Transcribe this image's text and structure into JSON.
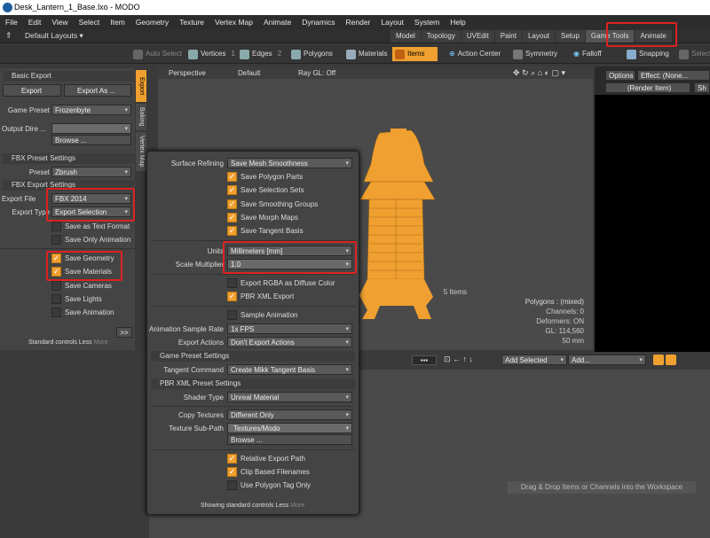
{
  "window_title": "Desk_Lantern_1_Base.lxo - MODO",
  "menu": [
    "File",
    "Edit",
    "View",
    "Select",
    "Item",
    "Geometry",
    "Texture",
    "Vertex Map",
    "Animate",
    "Dynamics",
    "Render",
    "Layout",
    "System",
    "Help"
  ],
  "layout_selector": "Default Layouts",
  "layout_tabs": [
    "Model",
    "Topology",
    "UVEdit",
    "Paint",
    "Layout",
    "Setup",
    "Game Tools",
    "Animate"
  ],
  "toolbar": {
    "auto_select": "Auto Select",
    "vertices": "Vertices",
    "vertices_count": "1",
    "edges": "Edges",
    "edges_count": "2",
    "polygons": "Polygons",
    "materials": "Materials",
    "items": "Items",
    "action_center": "Action Center",
    "symmetry": "Symmetry",
    "falloff": "Falloff",
    "snapping": "Snapping",
    "select": "Select"
  },
  "left_panel": {
    "basic_export_header": "Basic Export",
    "export_button": "Export",
    "export_as_button": "Export As ...",
    "game_preset_label": "Game Preset",
    "game_preset_value": "Frozenbyte",
    "output_dir_label": "Output Dire ...",
    "browse_button": "Browse ...",
    "fbx_preset_header": "FBX Preset Settings",
    "preset_label": "Preset",
    "preset_value": "Zbrush",
    "fbx_export_header": "FBX Export Settings",
    "export_file_label": "Export File",
    "export_file_value": "FBX 2014",
    "export_type_label": "Export Type",
    "export_type_value": "Export Selection",
    "save_text": "Save as Text Format",
    "save_anim_only": "Save Only Animation",
    "save_geometry": "Save Geometry",
    "save_materials": "Save Materials",
    "save_cameras": "Save Cameras",
    "save_lights": "Save Lights",
    "save_animation": "Save Animation",
    "standard_controls": "Standard controls",
    "less": "Less",
    "more": "More",
    "expand_button": ">>"
  },
  "vtabs": [
    "Export",
    "Baking",
    "Vertex Map"
  ],
  "viewport": {
    "perspective": "Perspective",
    "default": "Default",
    "ray_gl": "Ray GL: Off",
    "stats": [
      "5 Items",
      "Polygons : (mixed)",
      "Channels: 0",
      "Deformers: ON",
      "GL: 114,560",
      "50 mm"
    ]
  },
  "right_panel": {
    "options": "Options",
    "effect": "Effect: (None...",
    "render_item": "(Render Item)",
    "sh": "Sh"
  },
  "popup": {
    "surface_refining_label": "Surface Refining",
    "surface_refining_value": "Save Mesh Smoothness",
    "save_polygon_parts": "Save Polygon Parts",
    "save_selection_sets": "Save Selection Sets",
    "save_smoothing_groups": "Save Smoothing Groups",
    "save_morph_maps": "Save Morph Maps",
    "save_tangent_basis": "Save Tangent Basis",
    "units_label": "Units",
    "units_value": "Millimeters [mm]",
    "scale_label": "Scale Multiplier",
    "scale_value": "1.0",
    "export_rgba": "Export RGBA as Diffuse Color",
    "pbr_xml_export": "PBR XML Export",
    "sample_animation": "Sample Animation",
    "anim_rate_label": "Animation Sample Rate",
    "anim_rate_value": "1x FPS",
    "export_actions_label": "Export Actions",
    "export_actions_value": "Don't Export Actions",
    "game_preset_header": "Game Preset Settings",
    "tangent_label": "Tangent Command",
    "tangent_value": "Create Mikk Tangent Basis",
    "pbr_header": "PBR XML Preset Settings",
    "shader_label": "Shader Type",
    "shader_value": "Unreal Material",
    "copy_textures_label": "Copy Textures",
    "copy_textures_value": "Different Only",
    "texture_sub_label": "Texture Sub-Path",
    "texture_sub_value": "Textures/Modo",
    "browse_button": "Browse ...",
    "relative_path": "Relative Export Path",
    "clip_based": "Clip Based Filenames",
    "use_polygon_tag": "Use Polygon Tag Only",
    "footer": "Showing standard controls",
    "less": "Less",
    "more": "More"
  },
  "bottom": {
    "add_selected": "Add Selected",
    "add": "Add...",
    "drag_drop": "Drag & Drop Items or Channels into the Workspace"
  },
  "colors": {
    "accent": "#f0a030",
    "highlight_red": "#dd2222"
  }
}
